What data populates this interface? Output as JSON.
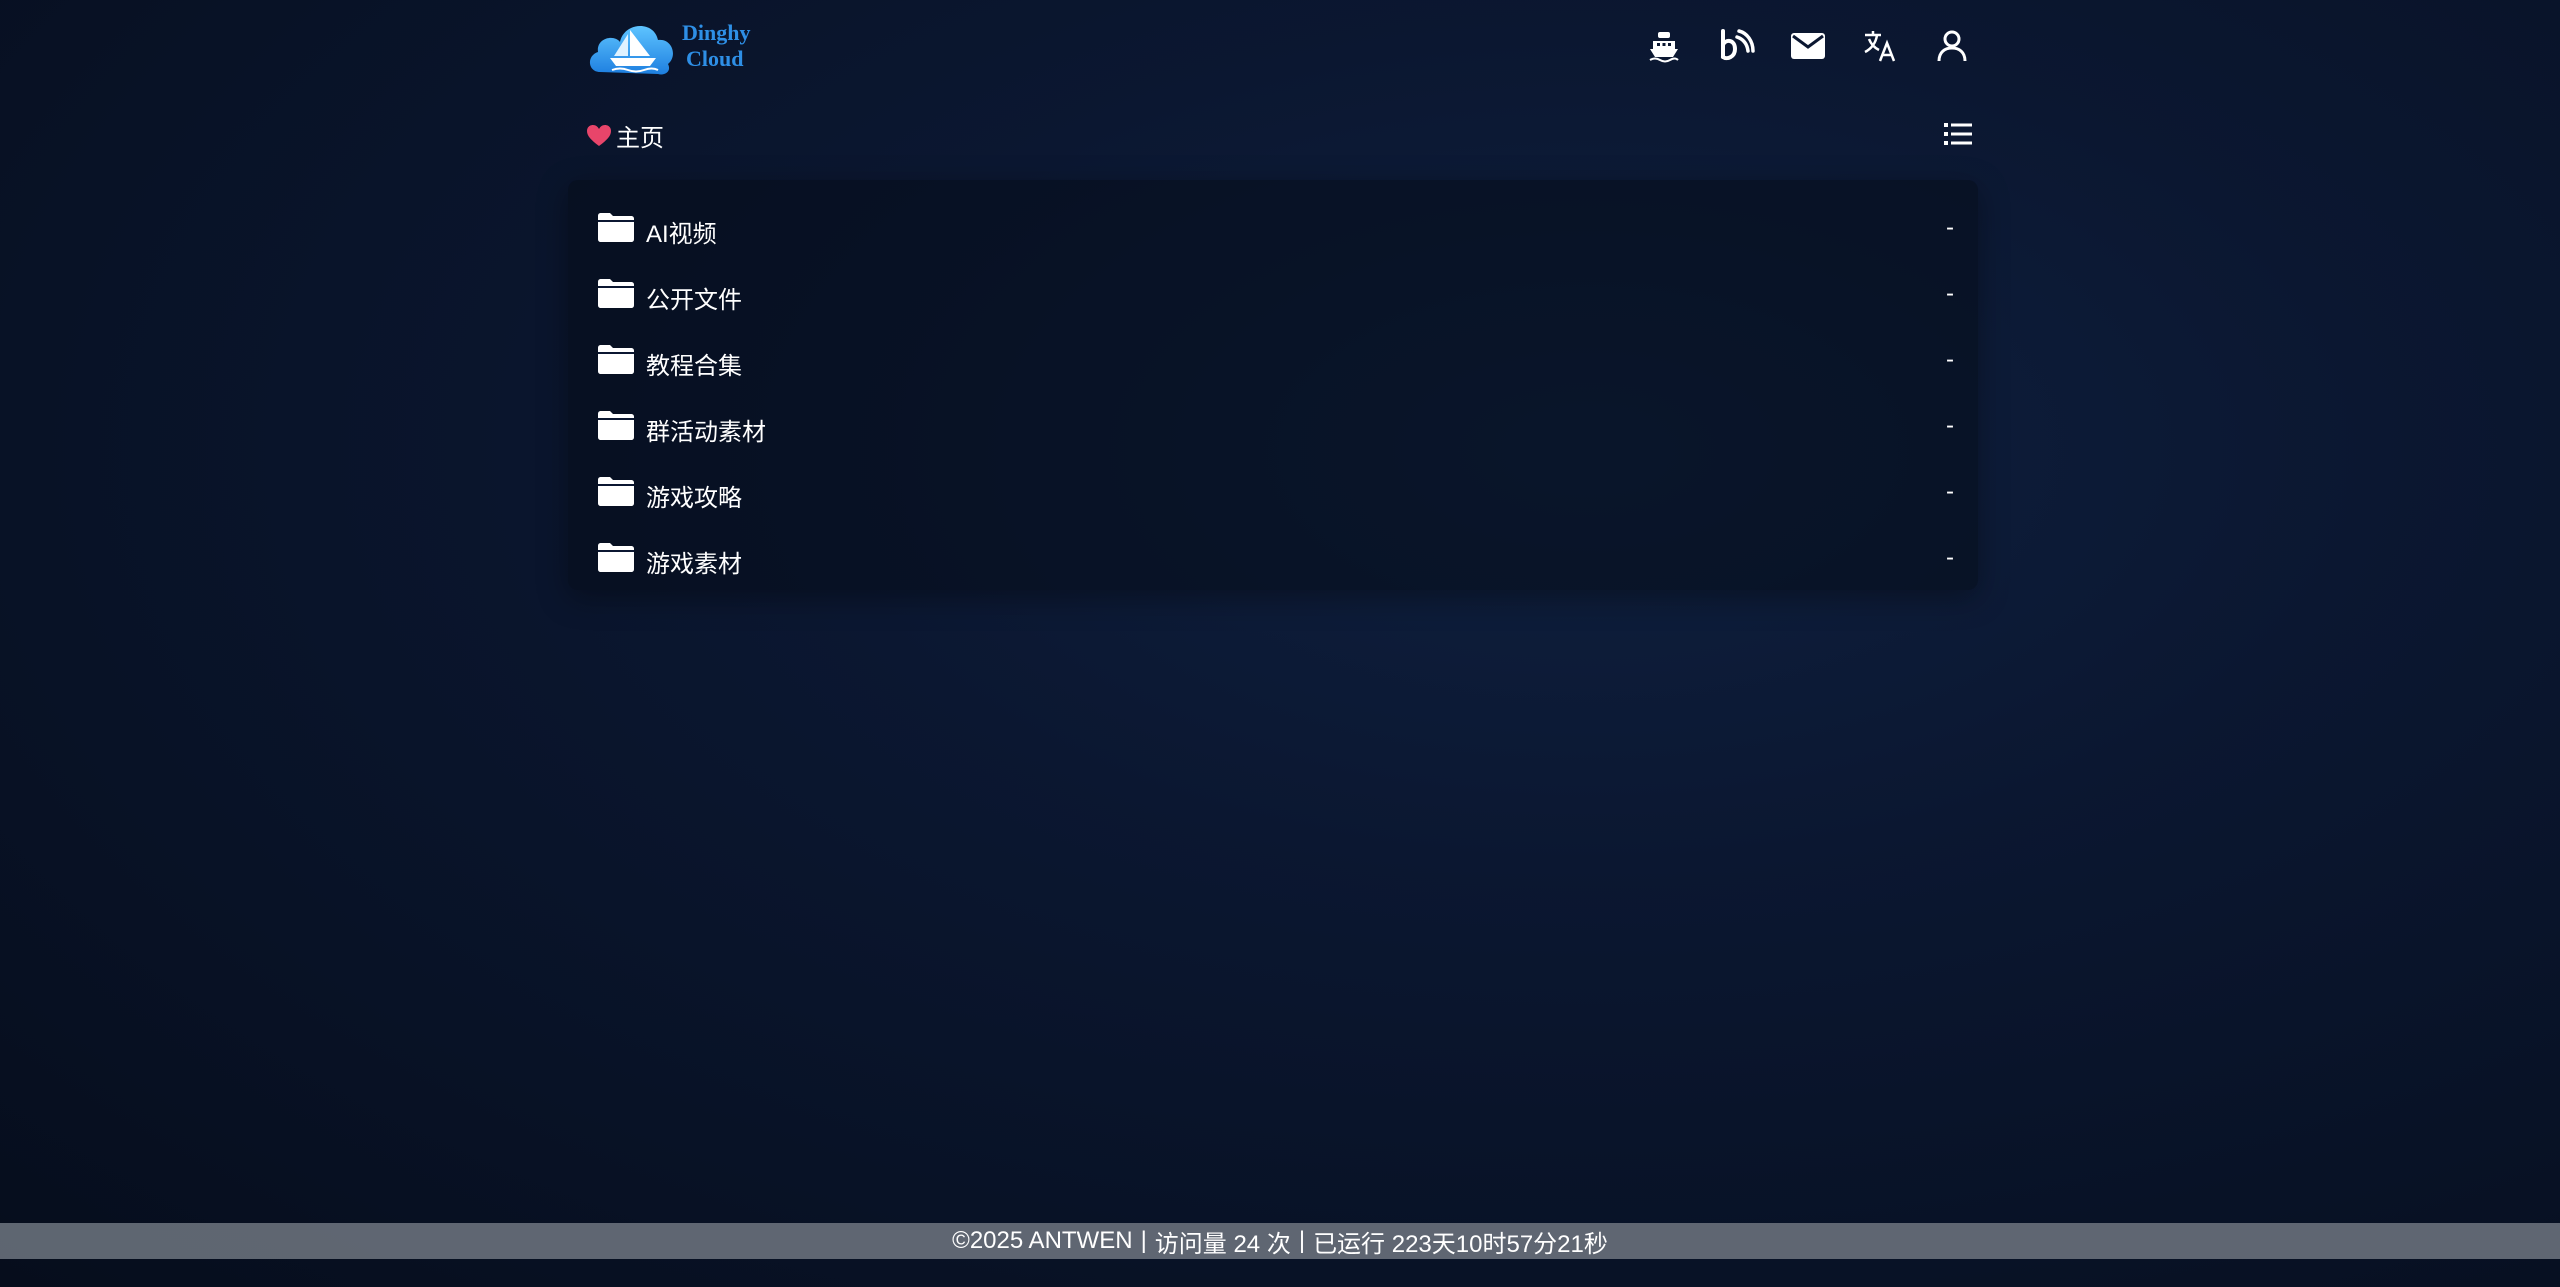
{
  "header": {
    "logo_line1": "Dinghy",
    "logo_line2": "Cloud",
    "icons": [
      "ship-icon",
      "bilibili-icon",
      "mail-icon",
      "translate-icon",
      "user-icon"
    ]
  },
  "nav": {
    "breadcrumb_label": "主页",
    "heart_color": "#e8456a"
  },
  "files": [
    {
      "name": "AI视频",
      "size": "-"
    },
    {
      "name": "公开文件",
      "size": "-"
    },
    {
      "name": "教程合集",
      "size": "-"
    },
    {
      "name": "群活动素材",
      "size": "-"
    },
    {
      "name": "游戏攻略",
      "size": "-"
    },
    {
      "name": "游戏素材",
      "size": "-"
    }
  ],
  "footer": {
    "copyright": "©2025 ANTWEN",
    "visits": "访问量 24 次",
    "uptime": "已运行 223天10时57分21秒",
    "separator": "|"
  },
  "colors": {
    "background": "#0b1731",
    "logo_text": "#2e8fe6",
    "footer_bar": "#6e7680"
  }
}
